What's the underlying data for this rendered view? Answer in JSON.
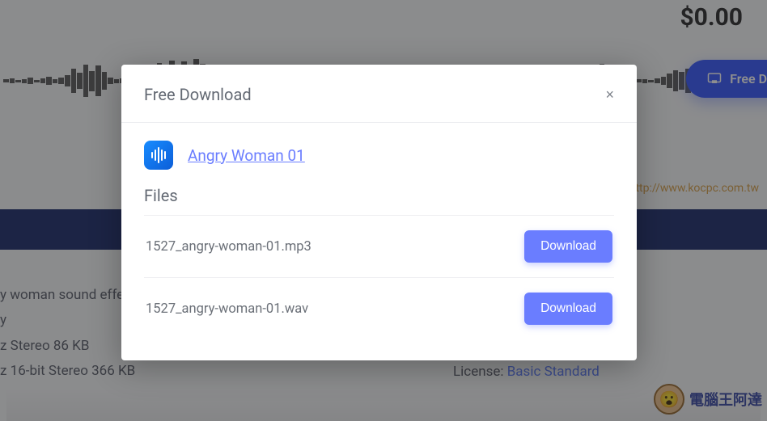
{
  "background": {
    "price": "$0.00",
    "freeDownloadBtn": "Free D",
    "details": {
      "line1": "y woman sound effe",
      "line2": "y",
      "line3": "z Stereo 86 KB",
      "line4": "z 16-bit Stereo 366 KB"
    },
    "licenseLabel": "License: ",
    "licenseLink": "Basic Standard",
    "watermark1": "http://www.kocpc.com.tw",
    "watermark2": "電腦王阿達"
  },
  "modal": {
    "title": "Free Download",
    "closeGlyph": "×",
    "item": {
      "title": "Angry Woman 01",
      "iconName": "audio-wave-icon"
    },
    "filesHeading": "Files",
    "files": [
      {
        "name": "1527_angry-woman-01.mp3",
        "action": "Download"
      },
      {
        "name": "1527_angry-woman-01.wav",
        "action": "Download"
      }
    ]
  }
}
